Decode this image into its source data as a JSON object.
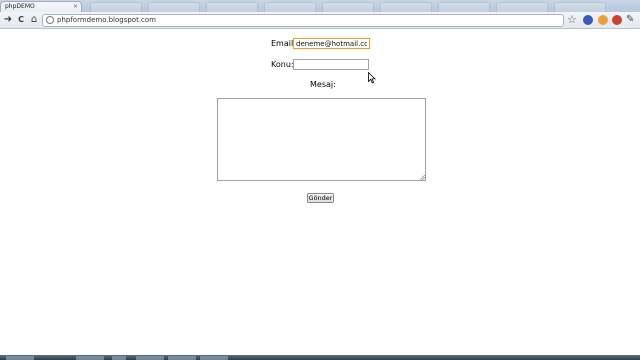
{
  "browser": {
    "tab_title": "phpDEMO",
    "tab_close": "×",
    "url": "phpformdemo.blogspot.com",
    "icons": [
      "back-icon",
      "reload-icon",
      "home-icon",
      "page-icon",
      "star-icon",
      "extension-icon",
      "wrench-icon"
    ],
    "back_glyph": "➜",
    "reload_glyph": "C",
    "home_glyph": "⌂",
    "star_glyph": "☆",
    "wrench_glyph": "✎"
  },
  "form": {
    "email_label": "Email:",
    "email_value": "deneme@hotmail.com",
    "subject_label": "Konu:",
    "subject_value": "",
    "message_label": "Mesaj:",
    "message_value": "",
    "submit_label": "Gönder"
  },
  "colors": {
    "focus_border": "#e6a23c",
    "tabstrip": "#c8d6e6",
    "taskbar": "#2f3c4f"
  }
}
